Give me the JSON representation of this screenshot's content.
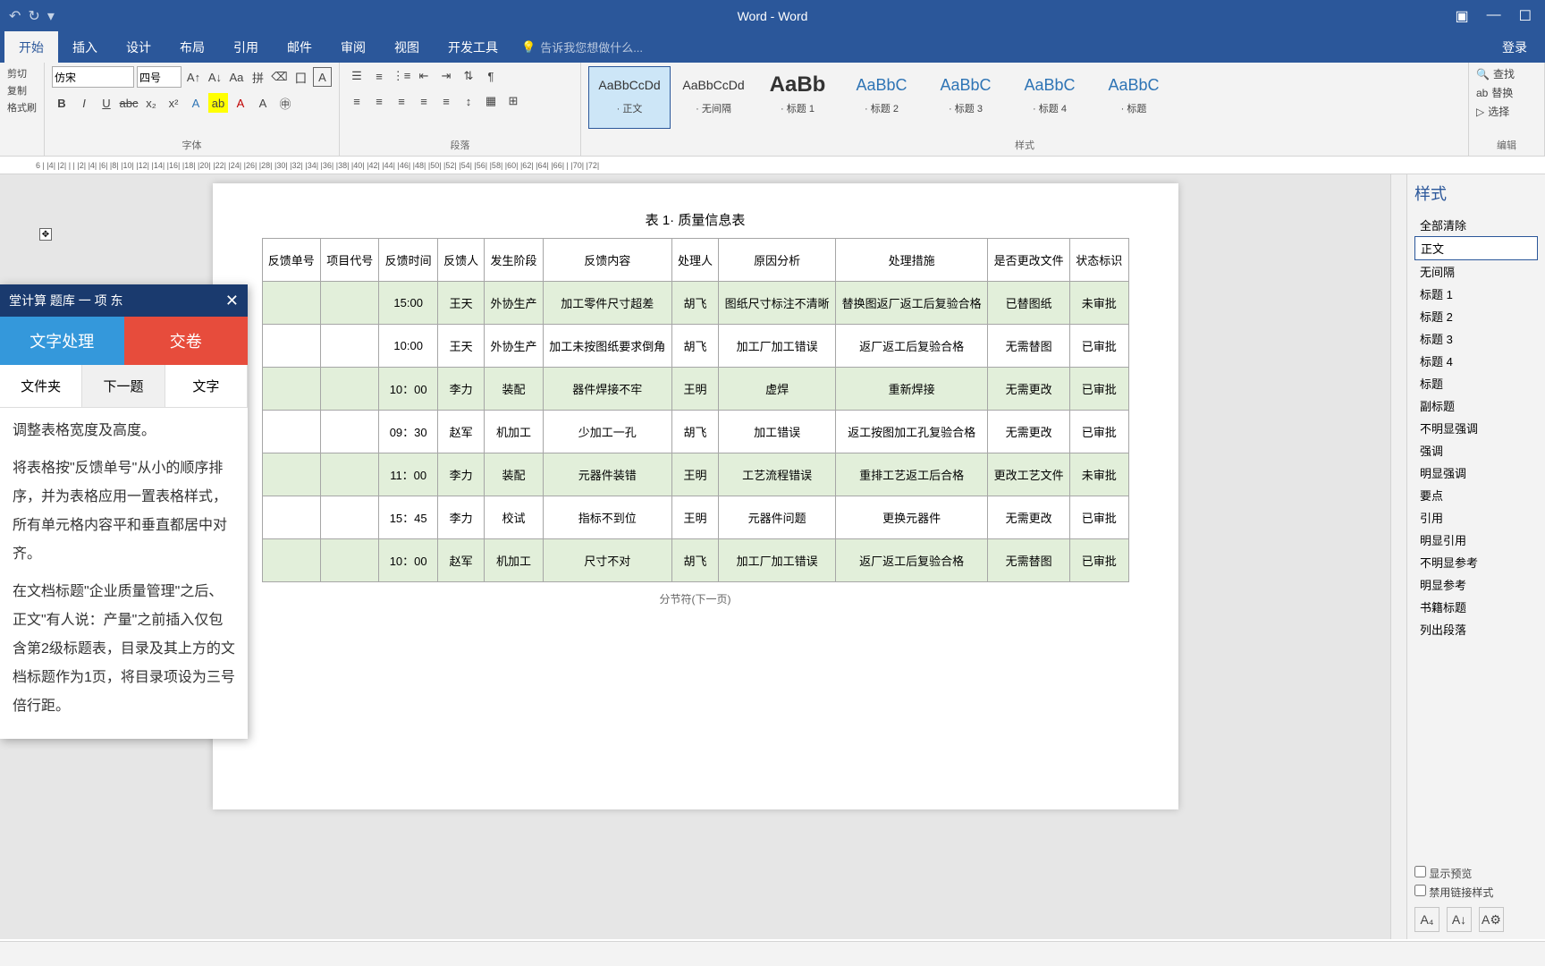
{
  "titlebar": {
    "title": "Word - Word"
  },
  "ribbon_tabs": [
    "开始",
    "插入",
    "设计",
    "布局",
    "引用",
    "邮件",
    "审阅",
    "视图",
    "开发工具"
  ],
  "tell_me": "告诉我您想做什么...",
  "login": "登录",
  "clipboard": {
    "cut": "剪切",
    "copy": "复制",
    "painter": "格式刷"
  },
  "font": {
    "name": "仿宋",
    "size": "四号",
    "group_label": "字体"
  },
  "paragraph": {
    "group_label": "段落"
  },
  "style_gallery": [
    {
      "preview": "AaBbCcDd",
      "name": "正文",
      "active": true
    },
    {
      "preview": "AaBbCcDd",
      "name": "无间隔"
    },
    {
      "preview": "AaBb",
      "name": "标题 1",
      "big": true
    },
    {
      "preview": "AaBbC",
      "name": "标题 2",
      "med": true
    },
    {
      "preview": "AaBbC",
      "name": "标题 3",
      "med": true
    },
    {
      "preview": "AaBbC",
      "name": "标题 4",
      "med": true
    },
    {
      "preview": "AaBbC",
      "name": "标题",
      "med": true
    }
  ],
  "styles_label": "样式",
  "edit": {
    "find": "查找",
    "replace": "替换",
    "select": "选择",
    "label": "编辑"
  },
  "doc": {
    "caption": "表 1· 质量信息表",
    "headers": [
      "反馈单号",
      "项目代号",
      "反馈时间",
      "反馈人",
      "发生阶段",
      "反馈内容",
      "处理人",
      "原因分析",
      "处理措施",
      "是否更改文件",
      "状态标识"
    ],
    "rows": [
      [
        "",
        "",
        "15:00",
        "王天",
        "外协生产",
        "加工零件尺寸超差",
        "胡飞",
        "图纸尺寸标注不清晰",
        "替换图返厂返工后复验合格",
        "已替图纸",
        "未审批"
      ],
      [
        "",
        "",
        "10:00",
        "王天",
        "外协生产",
        "加工未按图纸要求倒角",
        "胡飞",
        "加工厂加工错误",
        "返厂返工后复验合格",
        "无需替图",
        "已审批"
      ],
      [
        "",
        "",
        "10：00",
        "李力",
        "装配",
        "器件焊接不牢",
        "王明",
        "虚焊",
        "重新焊接",
        "无需更改",
        "已审批"
      ],
      [
        "",
        "",
        "09：30",
        "赵军",
        "机加工",
        "少加工一孔",
        "胡飞",
        "加工错误",
        "返工按图加工孔复验合格",
        "无需更改",
        "已审批"
      ],
      [
        "",
        "",
        "11：00",
        "李力",
        "装配",
        "元器件装错",
        "王明",
        "工艺流程错误",
        "重排工艺返工后合格",
        "更改工艺文件",
        "未审批"
      ],
      [
        "",
        "",
        "15：45",
        "李力",
        "校试",
        "指标不到位",
        "王明",
        "元器件问题",
        "更换元器件",
        "无需更改",
        "已审批"
      ],
      [
        "",
        "",
        "10：00",
        "赵军",
        "机加工",
        "尺寸不对",
        "胡飞",
        "加工厂加工错误",
        "返厂返工后复验合格",
        "无需替图",
        "已审批"
      ]
    ],
    "section_break": "分节符(下一页)"
  },
  "styles_pane": {
    "title": "样式",
    "items": [
      "全部清除",
      "正文",
      "无间隔",
      "标题 1",
      "标题 2",
      "标题 3",
      "标题 4",
      "标题",
      "副标题",
      "不明显强调",
      "强调",
      "明显强调",
      "要点",
      "引用",
      "明显引用",
      "不明显参考",
      "明显参考",
      "书籍标题",
      "列出段落"
    ],
    "active_index": 1,
    "show_preview": "显示预览",
    "disable_linked": "禁用链接样式"
  },
  "overlay": {
    "title": "堂计算  题库 一  项  东",
    "tab1": "文字处理",
    "tab2": "交卷",
    "tb1": "文件夹",
    "tb2": "下一题",
    "tb3": "文字",
    "content_lines": [
      "调整表格宽度及高度。",
      "将表格按\"反馈单号\"从小的顺序排序，并为表格应用一置表格样式，所有单元格内容平和垂直都居中对齐。",
      "在文档标题\"企业质量管理\"之后、正文\"有人说：产量\"之前插入仅包含第2级标题表，目录及其上方的文档标题作为1页，将目录项设为三号倍行距。"
    ]
  },
  "chart_data": {
    "type": "table",
    "title": "表 1· 质量信息表",
    "columns": [
      "反馈单号",
      "项目代号",
      "反馈时间",
      "反馈人",
      "发生阶段",
      "反馈内容",
      "处理人",
      "原因分析",
      "处理措施",
      "是否更改文件",
      "状态标识"
    ],
    "rows": [
      {
        "反馈时间": "15:00",
        "反馈人": "王天",
        "发生阶段": "外协生产",
        "反馈内容": "加工零件尺寸超差",
        "处理人": "胡飞",
        "原因分析": "图纸尺寸标注不清晰",
        "处理措施": "替换图返厂返工后复验合格",
        "是否更改文件": "已替图纸",
        "状态标识": "未审批"
      },
      {
        "反馈时间": "10:00",
        "反馈人": "王天",
        "发生阶段": "外协生产",
        "反馈内容": "加工未按图纸要求倒角",
        "处理人": "胡飞",
        "原因分析": "加工厂加工错误",
        "处理措施": "返厂返工后复验合格",
        "是否更改文件": "无需替图",
        "状态标识": "已审批"
      },
      {
        "反馈时间": "10：00",
        "反馈人": "李力",
        "发生阶段": "装配",
        "反馈内容": "器件焊接不牢",
        "处理人": "王明",
        "原因分析": "虚焊",
        "处理措施": "重新焊接",
        "是否更改文件": "无需更改",
        "状态标识": "已审批"
      },
      {
        "反馈时间": "09：30",
        "反馈人": "赵军",
        "发生阶段": "机加工",
        "反馈内容": "少加工一孔",
        "处理人": "胡飞",
        "原因分析": "加工错误",
        "处理措施": "返工按图加工孔复验合格",
        "是否更改文件": "无需更改",
        "状态标识": "已审批"
      },
      {
        "反馈时间": "11：00",
        "反馈人": "李力",
        "发生阶段": "装配",
        "反馈内容": "元器件装错",
        "处理人": "王明",
        "原因分析": "工艺流程错误",
        "处理措施": "重排工艺返工后合格",
        "是否更改文件": "更改工艺文件",
        "状态标识": "未审批"
      },
      {
        "反馈时间": "15：45",
        "反馈人": "李力",
        "发生阶段": "校试",
        "反馈内容": "指标不到位",
        "处理人": "王明",
        "原因分析": "元器件问题",
        "处理措施": "更换元器件",
        "是否更改文件": "无需更改",
        "状态标识": "已审批"
      },
      {
        "反馈时间": "10：00",
        "反馈人": "赵军",
        "发生阶段": "机加工",
        "反馈内容": "尺寸不对",
        "处理人": "胡飞",
        "原因分析": "加工厂加工错误",
        "处理措施": "返厂返工后复验合格",
        "是否更改文件": "无需替图",
        "状态标识": "已审批"
      }
    ]
  }
}
